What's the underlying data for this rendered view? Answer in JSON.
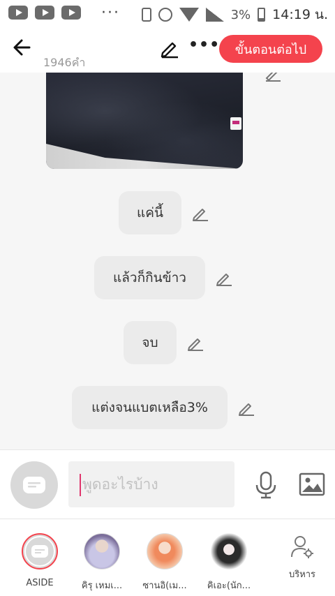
{
  "status_bar": {
    "battery_percent": "3%",
    "time": "14:19 น."
  },
  "header": {
    "word_count": "1946คำ",
    "next_label": "ขั้นตอนต่อไป"
  },
  "messages": [
    {
      "text": "แค่นี้"
    },
    {
      "text": "แล้วก็กินข้าว"
    },
    {
      "text": "จบ"
    },
    {
      "text": "แต่งจนแบตเหลือ3%"
    }
  ],
  "composer": {
    "placeholder": "พูดอะไรบ้าง"
  },
  "bottom_nav": {
    "items": [
      {
        "label": "ASIDE"
      },
      {
        "label": "คิรุ เหมเ..."
      },
      {
        "label": "ซานอิ(เม..."
      },
      {
        "label": "คิเอะ(นัก..."
      },
      {
        "label": "บริหาร"
      }
    ]
  },
  "colors": {
    "accent": "#f4434d",
    "bubble": "#ebebeb",
    "caret": "#e0356c"
  }
}
